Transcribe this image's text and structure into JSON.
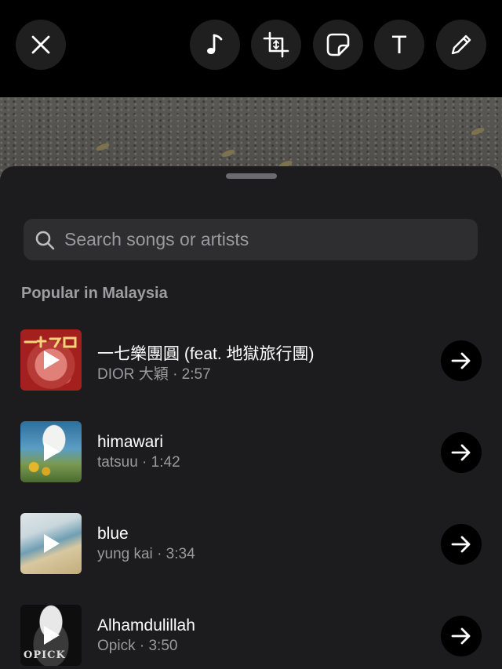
{
  "toolbar": {
    "close": "close-icon",
    "tools": [
      "music-note-icon",
      "crop-icon",
      "sticker-icon",
      "text-icon",
      "pencil-icon"
    ],
    "text_tool_label": "T"
  },
  "sheet": {
    "search": {
      "placeholder": "Search songs or artists",
      "value": ""
    },
    "section_title": "Popular in Malaysia",
    "songs": [
      {
        "title": "一七樂團圓 (feat. 地獄旅行團)",
        "artist": "DIOR 大穎",
        "duration": "2:57"
      },
      {
        "title": "himawari",
        "artist": "tatsuu",
        "duration": "1:42"
      },
      {
        "title": "blue",
        "artist": "yung kai",
        "duration": "3:34"
      },
      {
        "title": "Alhamdulillah",
        "artist": "Opick",
        "duration": "3:50"
      }
    ],
    "album_4_text": "OPICK"
  },
  "colors": {
    "background": "#000000",
    "sheet": "#1c1c1e",
    "search_bg": "#2e2e31",
    "secondary_text": "#9a9a9f",
    "button_bg": "#1f1f1f"
  }
}
